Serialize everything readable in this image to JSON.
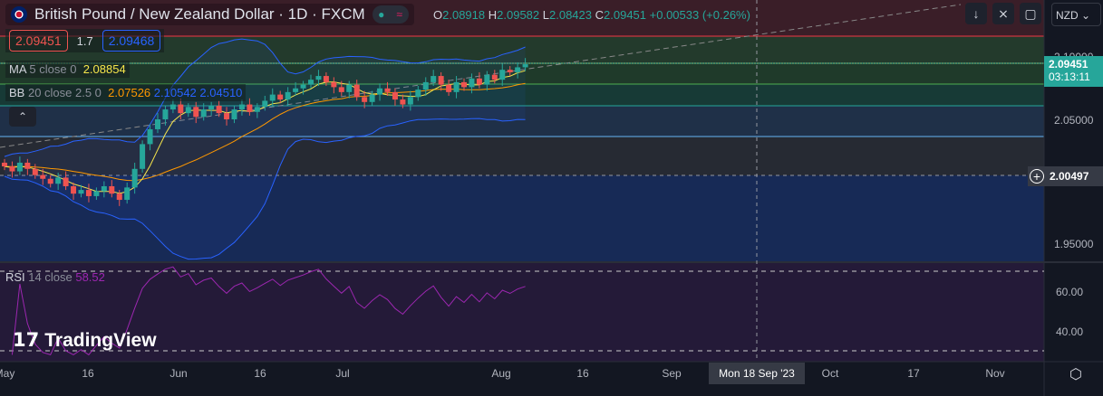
{
  "header": {
    "title": "British Pound / New Zealand Dollar · 1D · FXCM",
    "open_label": "O",
    "open": "2.08918",
    "high_label": "H",
    "high": "2.09582",
    "low_label": "L",
    "low": "2.08423",
    "close_label": "C",
    "close": "2.09451",
    "change": "+0.00533 (+0.26%)"
  },
  "trade": {
    "sell": "2.09451",
    "spread": "1.7",
    "buy": "2.09468"
  },
  "indicators": {
    "ma_name": "MA",
    "ma_params": "5 close 0",
    "ma_value": "2.08854",
    "bb_name": "BB",
    "bb_params": "20 close 2.5 0",
    "bb_basis": "2.07526",
    "bb_upper": "2.10542",
    "bb_lower": "2.04510",
    "rsi_name": "RSI",
    "rsi_params": "14 close",
    "rsi_value": "58.52"
  },
  "price_axis": {
    "currency": "NZD",
    "labels": [
      "2.10000",
      "2.05000",
      "1.95000"
    ],
    "current_price": "2.09451",
    "countdown": "03:13:11",
    "crosshair_price": "2.00497"
  },
  "rsi_axis": {
    "labels": [
      "60.00",
      "40.00"
    ]
  },
  "time_axis": {
    "labels": [
      "May",
      "16",
      "Jun",
      "16",
      "Jul",
      "Aug",
      "16",
      "Sep",
      "Oct",
      "17",
      "Nov"
    ],
    "crosshair_date": "Mon 18 Sep '23"
  },
  "branding": {
    "logo": "TradingView"
  },
  "colors": {
    "up": "#26a69a",
    "down": "#ef5350",
    "ma": "#f7e64b",
    "bb_basis": "#ff9800",
    "bb_band": "#2962ff",
    "rsi": "#9c27b0"
  },
  "chart_data": {
    "type": "candlestick",
    "symbol": "GBPNZD",
    "interval": "1D",
    "closes": [
      2.012,
      2.008,
      2.015,
      2.01,
      2.005,
      2.002,
      1.998,
      2.003,
      1.996,
      1.99,
      1.993,
      1.988,
      1.992,
      1.996,
      1.99,
      1.985,
      1.995,
      2.01,
      2.03,
      2.042,
      2.05,
      2.058,
      2.062,
      2.055,
      2.06,
      2.052,
      2.058,
      2.061,
      2.055,
      2.05,
      2.058,
      2.062,
      2.056,
      2.06,
      2.065,
      2.07,
      2.066,
      2.072,
      2.075,
      2.078,
      2.082,
      2.085,
      2.08,
      2.076,
      2.072,
      2.078,
      2.068,
      2.064,
      2.07,
      2.075,
      2.072,
      2.066,
      2.062,
      2.068,
      2.074,
      2.08,
      2.085,
      2.078,
      2.072,
      2.08,
      2.076,
      2.083,
      2.078,
      2.086,
      2.082,
      2.09,
      2.088,
      2.092,
      2.0945
    ],
    "price_range": [
      1.925,
      2.135
    ],
    "rsi_range": [
      25,
      80
    ]
  }
}
